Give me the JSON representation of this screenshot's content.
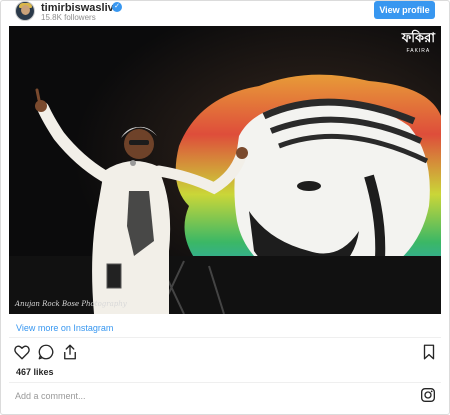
{
  "header": {
    "username": "timirbiswaslive",
    "verified_icon": "verified-badge-icon",
    "followers": "15.8K followers",
    "view_profile_label": "View profile"
  },
  "photo": {
    "logo_text": "ফকিরা",
    "logo_subtext": "FAKIRA",
    "credit_text": "Anujan Rock Bose Photography"
  },
  "footer": {
    "view_more": "View more on Instagram",
    "likes": "467 likes",
    "comment_placeholder": "Add a comment...",
    "icons": [
      "heart-icon",
      "comment-icon",
      "share-icon",
      "bookmark-icon",
      "instagram-icon"
    ]
  },
  "colors": {
    "accent": "#3897f0",
    "text": "#262626",
    "muted": "#8e8e8e"
  }
}
